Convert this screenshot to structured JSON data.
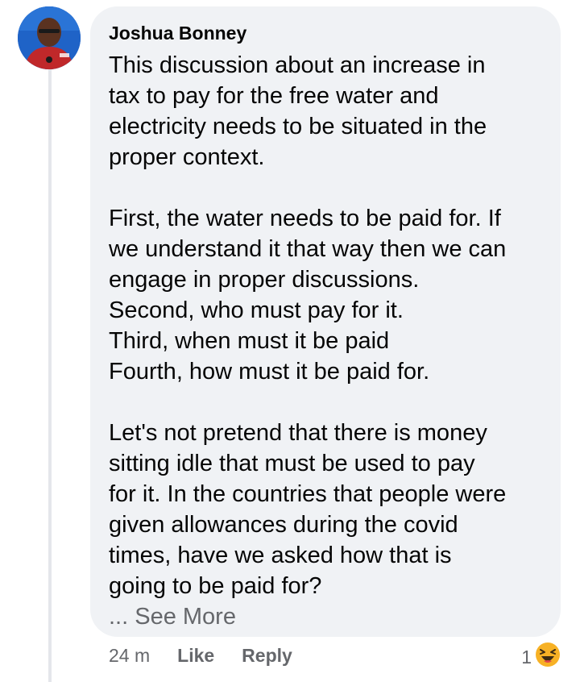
{
  "comment": {
    "author": "Joshua Bonney",
    "paragraphs": [
      [
        "This discussion about an increase in",
        "tax to pay for the free water and",
        "electricity needs to be situated in the",
        "proper context."
      ],
      [
        "First, the water needs to be paid for. If",
        "we understand it that way then we can",
        "engage in proper discussions.",
        "Second, who must pay for it.",
        "Third, when must it be paid",
        "Fourth, how must it be paid for."
      ],
      [
        "Let's not pretend that there is money",
        "sitting idle that must be used to pay",
        "for it. In the countries that people were",
        "given allowances during the covid",
        "times, have we asked how that is",
        "going to be paid for?"
      ]
    ],
    "see_more_label": "... See More"
  },
  "actions": {
    "timestamp": "24 m",
    "like_label": "Like",
    "reply_label": "Reply"
  },
  "reactions": {
    "count": "1",
    "icon": "haha-emoji-icon"
  },
  "colors": {
    "bubble": "#f0f2f5",
    "text": "#050505",
    "secondary": "#65676b",
    "thread_line": "#e4e6eb",
    "emoji": "#f7b125"
  }
}
